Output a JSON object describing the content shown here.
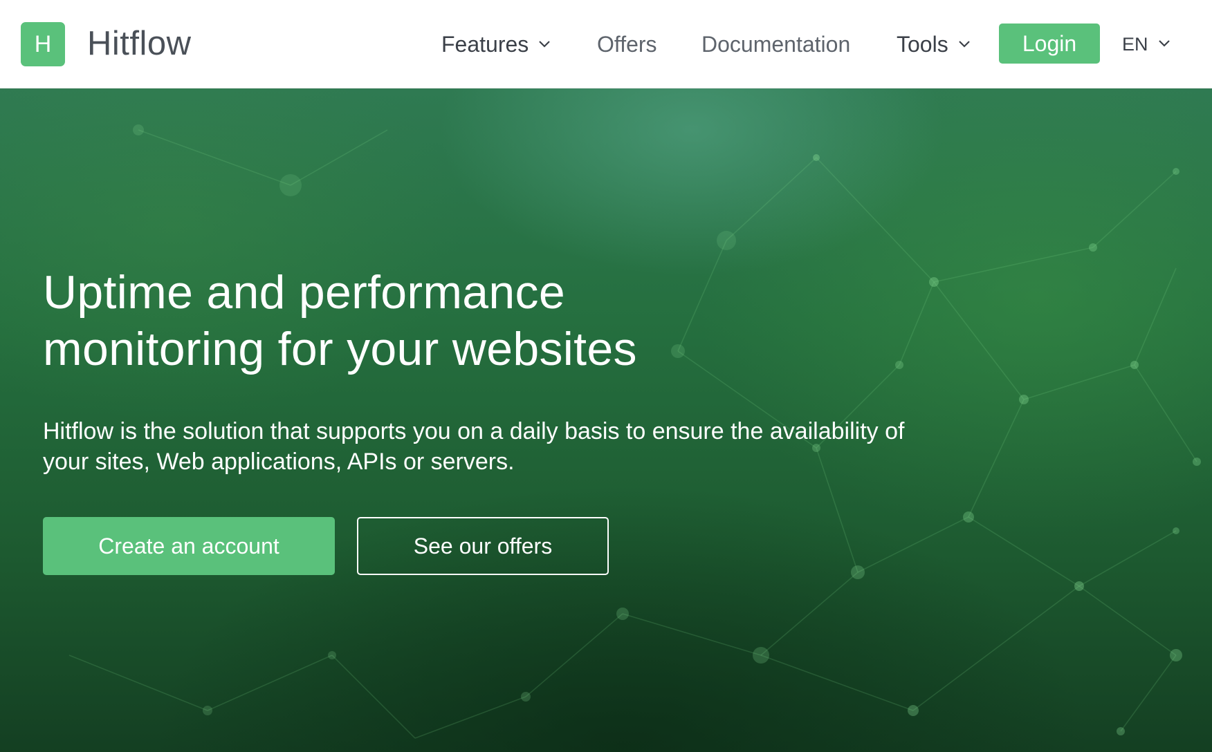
{
  "colors": {
    "brand_green": "#5ac17b",
    "nav_text": "#3b4048",
    "hero_background": "#256f3f"
  },
  "header": {
    "logo_letter": "H",
    "brand_name": "Hitflow",
    "nav": {
      "features": "Features",
      "offers": "Offers",
      "documentation": "Documentation",
      "tools": "Tools"
    },
    "login_label": "Login",
    "language": "EN",
    "icons": [
      "chevron-down-icon"
    ]
  },
  "hero": {
    "headline_line1": "Uptime and performance",
    "headline_line2": "monitoring for your websites",
    "subtext_line1": "Hitflow is the solution that supports you on a daily basis to ensure the availability of",
    "subtext_line2": "your sites, Web applications, APIs or servers.",
    "primary_button": "Create an account",
    "secondary_button": "See our offers"
  }
}
